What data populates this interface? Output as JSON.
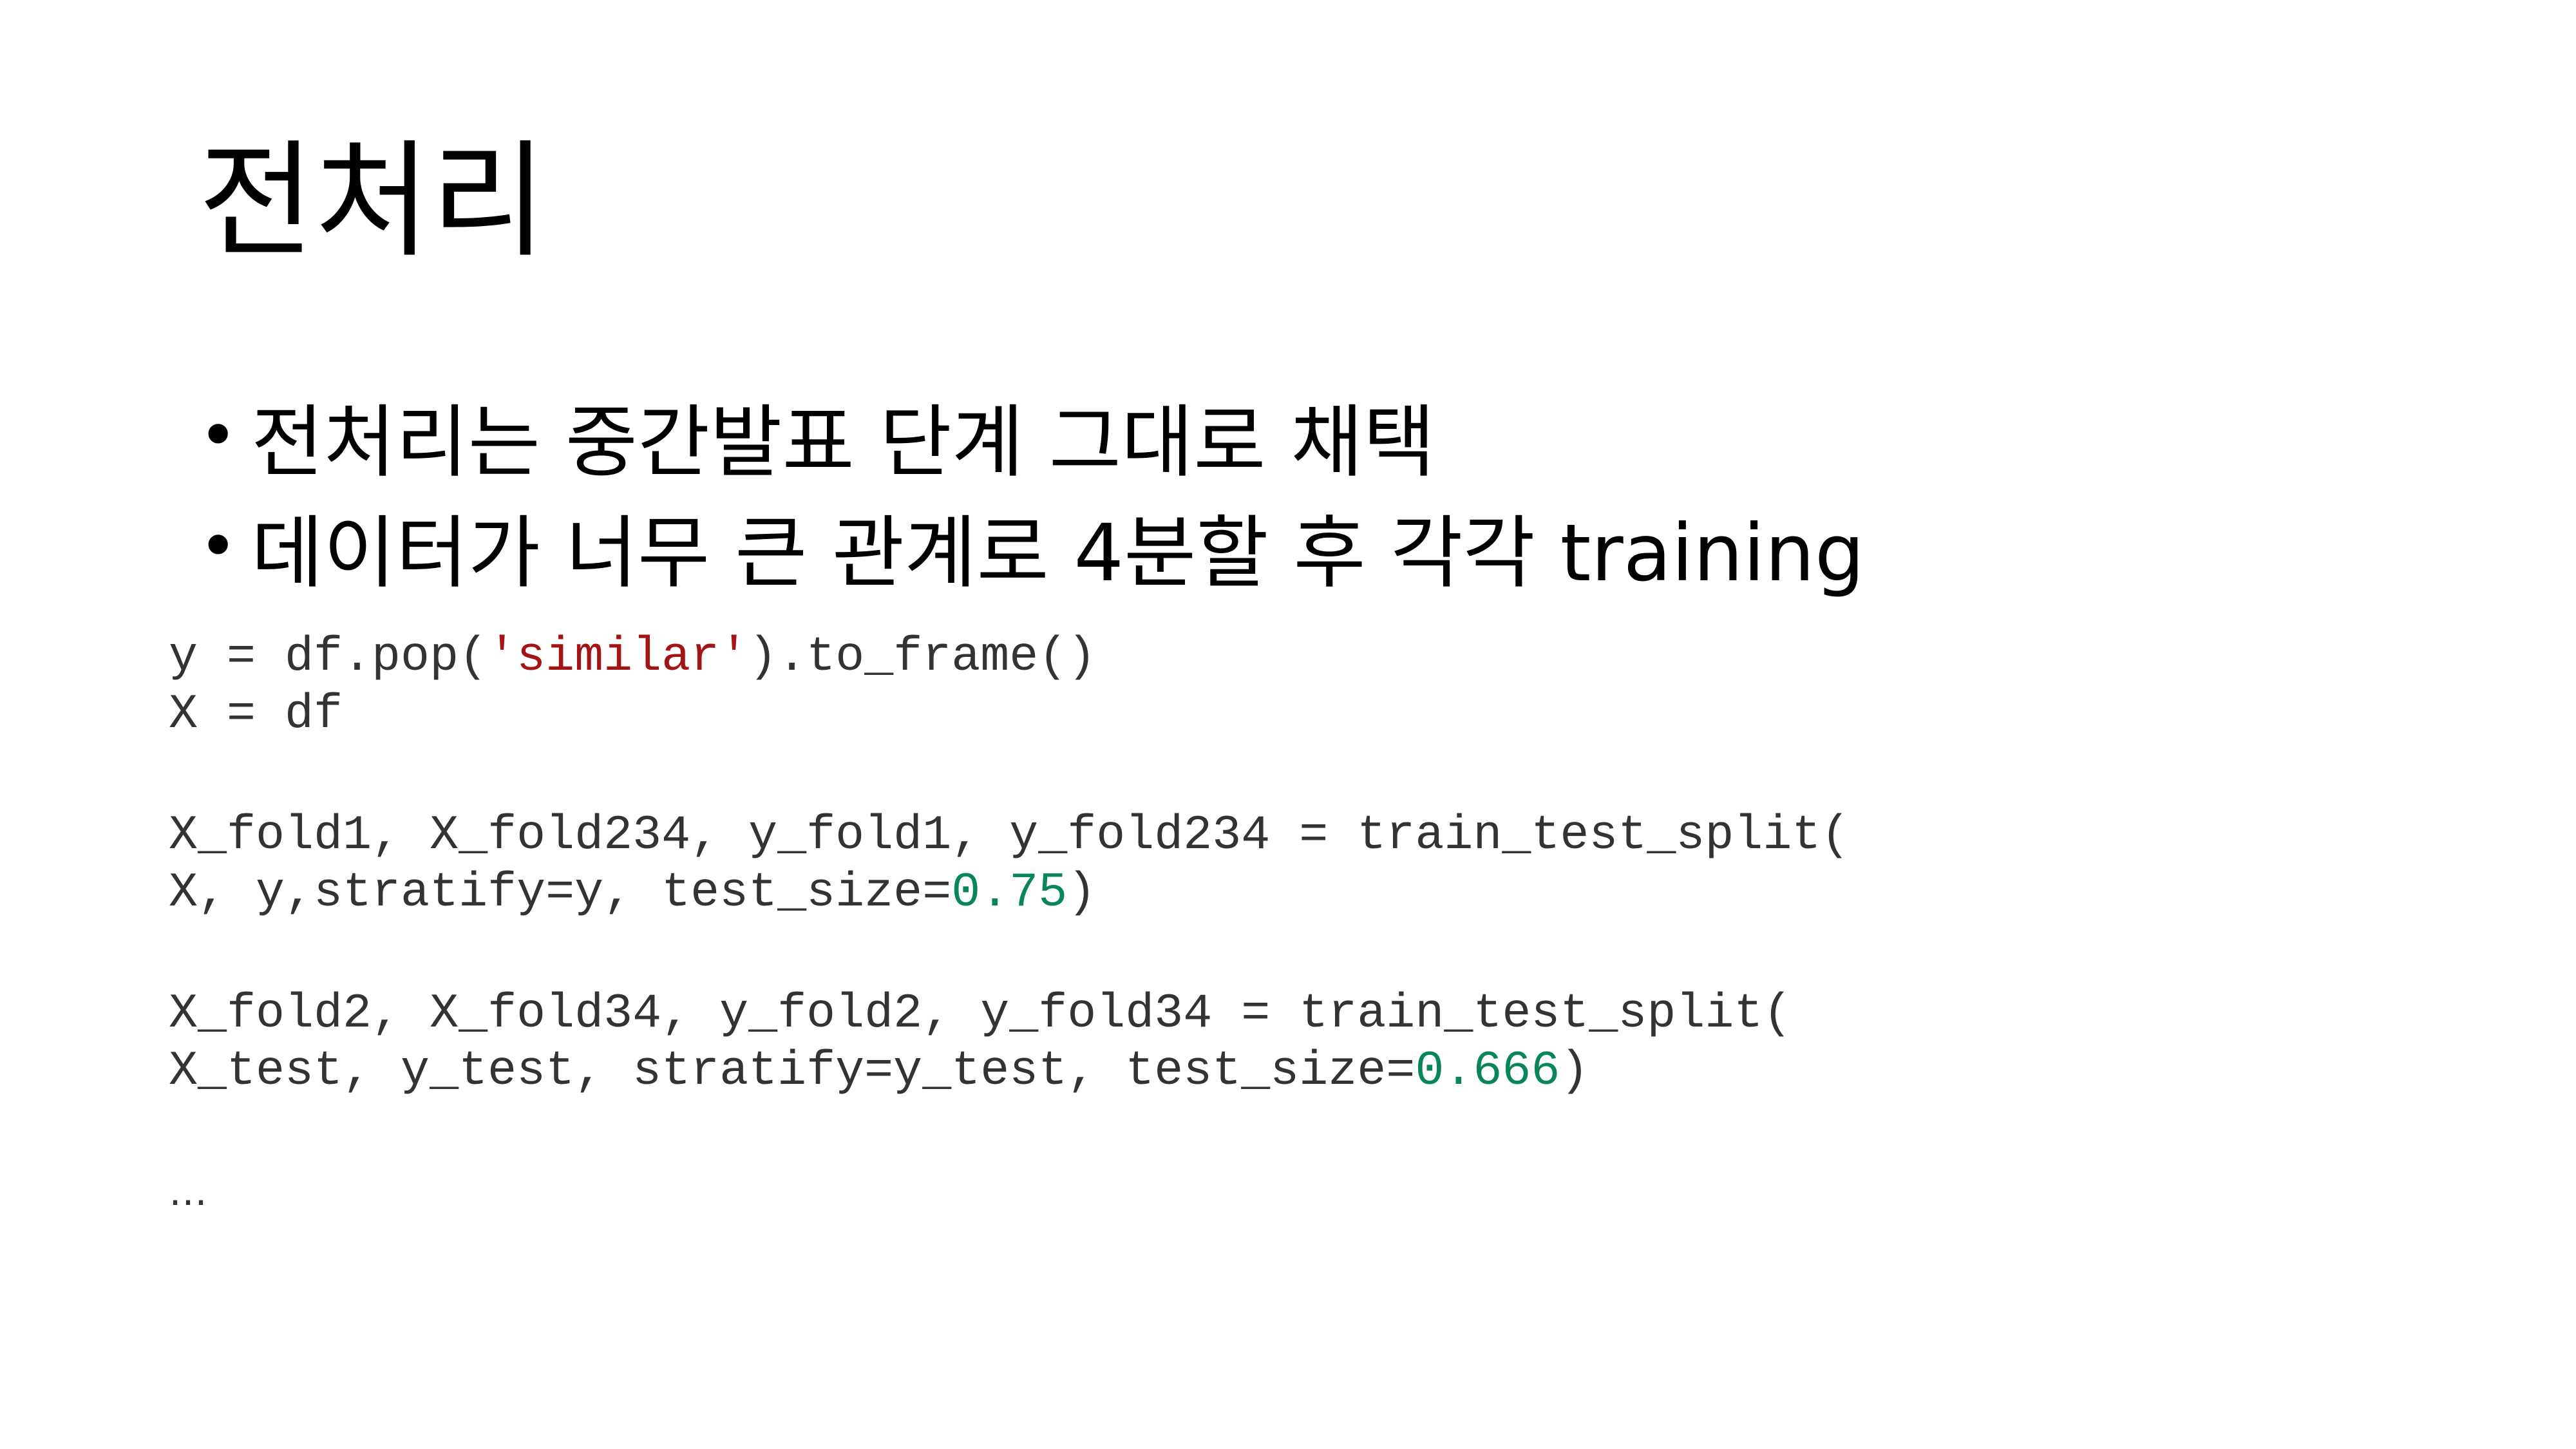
{
  "slide": {
    "title": "전처리",
    "bullets": [
      "전처리는 중간발표 단계 그대로 채택",
      "데이터가 너무 큰 관계로 4분할 후 각각 training"
    ],
    "bullet_symbol": "•"
  },
  "code": {
    "line1": {
      "a": "y = df.pop(",
      "str": "'similar'",
      "b": ").to_frame()"
    },
    "line2": "X = df",
    "line3": "X_fold1, X_fold234, y_fold1, y_fold234 = train_test_split(",
    "line4": {
      "a": "X, y,stratify=y, test_size=",
      "num": "0.75",
      "b": ")"
    },
    "line5": "X_fold2, X_fold34, y_fold2, y_fold34 = train_test_split(",
    "line6": {
      "a": "X_test, y_test, stratify=y_test, test_size=",
      "num": "0.666",
      "b": ")"
    },
    "ellipsis": "…",
    "colors": {
      "text": "#333333",
      "string": "#a31515",
      "number": "#098658"
    }
  }
}
